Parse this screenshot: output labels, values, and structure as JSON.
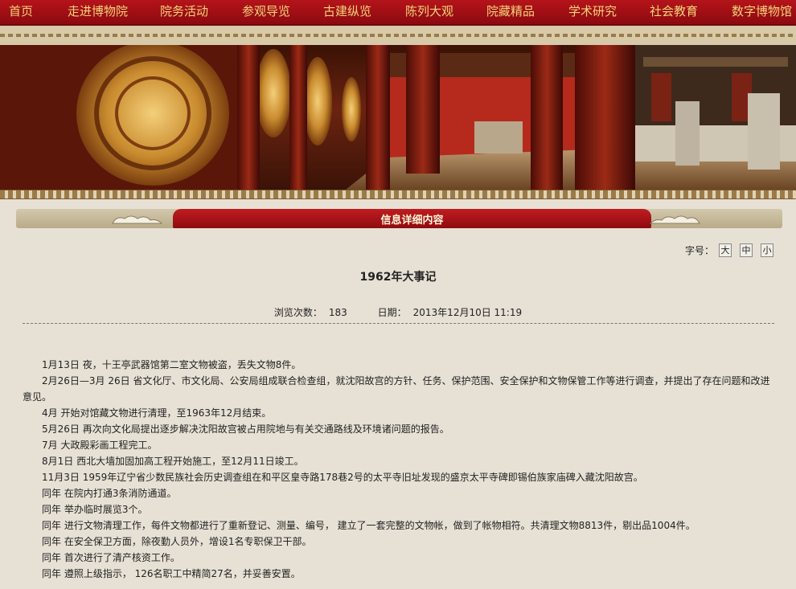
{
  "nav": {
    "items": [
      "首页",
      "走进博物院",
      "院务活动",
      "参观导览",
      "古建纵览",
      "陈列大观",
      "院藏精品",
      "学术研究",
      "社会教育",
      "数字博物馆"
    ]
  },
  "section": {
    "title": "信息详细内容"
  },
  "fontsize": {
    "label": "字号：",
    "large": "大",
    "medium": "中",
    "small": "小"
  },
  "article": {
    "title": "1962年大事记",
    "views_label": "浏览次数：",
    "views": "183",
    "date_label": "日期：",
    "date": "2013年12月10日 11:19",
    "paragraphs": [
      "1月13日 夜，十王亭武器馆第二室文物被盗，丢失文物8件。",
      "2月26日—3月 26日 省文化厅、市文化局、公安局组成联合检查组，就沈阳故宫的方针、任务、保护范围、安全保护和文物保管工作等进行调查，并提出了存在问题和改进意见。",
      "4月 开始对馆藏文物进行清理，至1963年12月结束。",
      "5月26日 再次向文化局提出逐步解决沈阳故宫被占用院地与有关交通路线及环境诸问题的报告。",
      "7月 大政殿彩画工程完工。",
      "8月1日 西北大墙加固加高工程开始施工，至12月11日竣工。",
      "11月3日 1959年辽宁省少数民族社会历史调查组在和平区皇寺路178巷2号的太平寺旧址发现的盛京太平寺碑即锡伯族家庙碑入藏沈阳故宫。",
      "同年 在院内打通3条消防通道。",
      "同年 举办临时展览3个。",
      "同年 进行文物清理工作，每件文物都进行了重新登记、测量、编号， 建立了一套完整的文物帐，做到了帐物相符。共清理文物8813件，剔出品1004件。",
      "同年 在安全保卫方面，除夜勤人员外，增设1名专职保卫干部。",
      "同年 首次进行了清产核资工作。",
      "同年 遵照上级指示， 126名职工中精简27名，并妥善安置。"
    ]
  },
  "colors": {
    "nav_bg": "#a3111a",
    "nav_text": "#f3d27a",
    "page_bg": "#e7e1d5",
    "accent_red": "#b0161c"
  }
}
